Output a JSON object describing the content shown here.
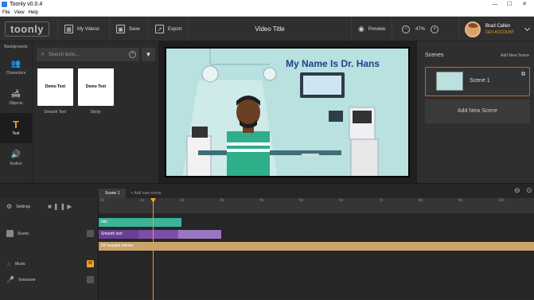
{
  "window": {
    "title": "Toonly v0.0.4",
    "minimize": "—",
    "maximize": "☐",
    "close": "✕"
  },
  "menu": [
    "File",
    "View",
    "Help"
  ],
  "topbar": {
    "logo": "toonly",
    "my_videos": "My Videos",
    "save": "Save",
    "export": "Export",
    "video_title": "Video Title",
    "preview": "Preview",
    "zoom_value": "47%",
    "user_name": "Brad Callen",
    "account": "DEV ACCOUNT"
  },
  "left_nav": {
    "header": "Backgrounds",
    "items": [
      {
        "label": "Characters",
        "icon": "people-icon"
      },
      {
        "label": "Objects",
        "icon": "sofa-icon"
      },
      {
        "label": "Text",
        "icon": "text-icon",
        "active": true
      },
      {
        "label": "Audios",
        "icon": "audio-icon"
      }
    ]
  },
  "text_panel": {
    "search_placeholder": "Search texts...",
    "cards": [
      {
        "preview": "Demo Text",
        "label": "Smooth Text"
      },
      {
        "preview": "Demo Text",
        "label": "Sticky"
      }
    ]
  },
  "canvas": {
    "heading": "My Name Is Dr. Hans",
    "background": "#b8e1df"
  },
  "scenes_panel": {
    "title": "Scenes",
    "add_link": "Add New Scene",
    "scene_name": "Scene 1",
    "add_button": "Add New Scene"
  },
  "timeline": {
    "tab": "Scene 1",
    "add_tab": "+ Add new scene",
    "settings_label": "Settings",
    "ruler_ticks": [
      "0s",
      "1s",
      "2s",
      "3s",
      "4s",
      "5s",
      "6s",
      "7s",
      "8s",
      "9s",
      "10s"
    ],
    "rows": [
      {
        "label": "Scene",
        "badge": ""
      },
      {
        "label": "Music",
        "badge": "M"
      },
      {
        "label": "Voiceover",
        "badge": ""
      }
    ],
    "tracks": [
      {
        "label": "Idle",
        "color": "#3bb39a"
      },
      {
        "label": "Smooth text",
        "color": "#7b4fa8"
      },
      {
        "label": "24 hospital interior",
        "color": "#c9a36a"
      }
    ]
  },
  "colors": {
    "accent": "#f0a020",
    "scene_border": "#c86420"
  }
}
